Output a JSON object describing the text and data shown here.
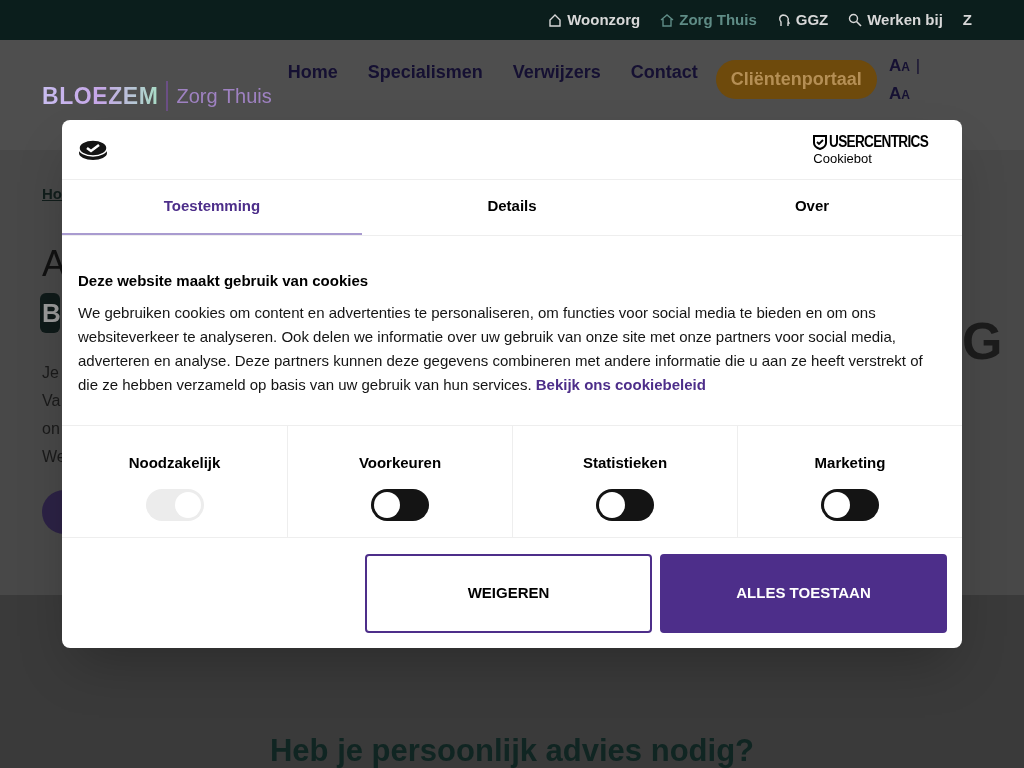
{
  "top_links": [
    {
      "label": "Woonzorg",
      "kind": "house",
      "selected": false
    },
    {
      "label": "Zorg Thuis",
      "kind": "home",
      "selected": true
    },
    {
      "label": "GGZ",
      "kind": "head",
      "selected": false
    },
    {
      "label": "Werken bij",
      "kind": "search",
      "selected": false
    },
    {
      "label": "Z",
      "kind": "none",
      "selected": false
    }
  ],
  "logo": {
    "brand": "BLOEZEM",
    "sub": "Zorg Thuis"
  },
  "nav": [
    "Home",
    "Specialismen",
    "Verwijzers",
    "Contact"
  ],
  "portal_button": "Cliëntenportaal",
  "font_controls": [
    "Aa",
    "|",
    "Aa"
  ],
  "background_fragments": {
    "breadcrumb": "Ho",
    "heading_1": "A",
    "heading_2": "B",
    "lines": [
      "Je",
      "Va",
      "on",
      "We"
    ],
    "right_letter": "G"
  },
  "bottom_heading": "Heb je persoonlijk advies nodig?",
  "dialog": {
    "brand": "USERCENTRICS",
    "brand_sub": "Cookiebot",
    "tabs": [
      {
        "label": "Toestemming",
        "selected": true
      },
      {
        "label": "Details",
        "selected": false
      },
      {
        "label": "Over",
        "selected": false
      }
    ],
    "title": "Deze website maakt gebruik van cookies",
    "body": "We gebruiken cookies om content en advertenties te personaliseren, om functies voor social media te bieden en om ons websiteverkeer te analyseren. Ook delen we informatie over uw gebruik van onze site met onze partners voor social media, adverteren en analyse. Deze partners kunnen deze gegevens combineren met andere informatie die u aan ze heeft verstrekt of die ze hebben verzameld op basis van uw gebruik van hun services.",
    "link": "Bekijk ons cookiebeleid",
    "categories": [
      {
        "label": "Noodzakelijk",
        "checked": true,
        "disabled": true
      },
      {
        "label": "Voorkeuren",
        "checked": false,
        "disabled": false
      },
      {
        "label": "Statistieken",
        "checked": false,
        "disabled": false
      },
      {
        "label": "Marketing",
        "checked": false,
        "disabled": false
      }
    ],
    "buttons": [
      {
        "label": "WEIGEREN",
        "kind": "outline"
      },
      {
        "label": "ALLES TOESTAAN",
        "kind": "primary"
      }
    ]
  }
}
